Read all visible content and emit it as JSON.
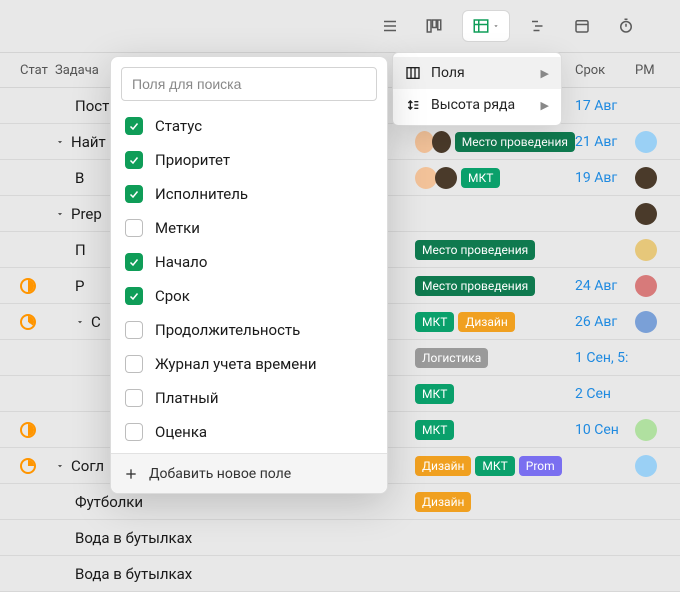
{
  "toolbar": {
    "icons": [
      "list-icon",
      "board-icon",
      "table-icon",
      "gantt-icon",
      "calendar-like-icon",
      "timer-icon"
    ],
    "active_index": 2
  },
  "columns": {
    "status": "Стат",
    "task": "Задача",
    "due": "Срок",
    "pm": "PM"
  },
  "view_popover": {
    "items": [
      {
        "icon": "columns-icon",
        "label": "Поля",
        "active": true,
        "has_sub": true
      },
      {
        "icon": "row-height-icon",
        "label": "Высота ряда",
        "active": false,
        "has_sub": true
      }
    ]
  },
  "fields_panel": {
    "search_placeholder": "Поля для поиска",
    "add_label": "Добавить новое поле",
    "items": [
      {
        "label": "Статус",
        "checked": true
      },
      {
        "label": "Приоритет",
        "checked": true
      },
      {
        "label": "Исполнитель",
        "checked": true
      },
      {
        "label": "Метки",
        "checked": false
      },
      {
        "label": "Начало",
        "checked": true
      },
      {
        "label": "Срок",
        "checked": true
      },
      {
        "label": "Продолжительность",
        "checked": false
      },
      {
        "label": "Журнал учета времени",
        "checked": false
      },
      {
        "label": "Платный",
        "checked": false
      },
      {
        "label": "Оценка",
        "checked": false
      }
    ]
  },
  "rows": [
    {
      "indent": 1,
      "disclose": false,
      "status": null,
      "title": "Пост",
      "tags": [],
      "due": "17 Авг",
      "avatars": []
    },
    {
      "indent": 0,
      "disclose": true,
      "status": null,
      "title": "Найт",
      "tags": [
        {
          "t": "Место проведения",
          "c": "green"
        }
      ],
      "due": "21 Авг",
      "avatars": [
        "a",
        "b",
        "c"
      ]
    },
    {
      "indent": 1,
      "disclose": false,
      "status": null,
      "title": "В",
      "tags": [
        {
          "t": "МКТ",
          "c": "teal"
        }
      ],
      "due": "19 Авг",
      "avatars": [
        "a",
        "b"
      ]
    },
    {
      "indent": 0,
      "disclose": true,
      "status": null,
      "title": "Prep",
      "tags": [],
      "due": "",
      "avatars": [
        "b"
      ]
    },
    {
      "indent": 1,
      "disclose": false,
      "status": null,
      "title": "П",
      "tags": [
        {
          "t": "Место проведения",
          "c": "green"
        }
      ],
      "due": "",
      "avatars": [
        "d"
      ]
    },
    {
      "indent": 1,
      "disclose": false,
      "status": "50",
      "title": "Р",
      "tags": [
        {
          "t": "Место проведения",
          "c": "green"
        }
      ],
      "due": "24 Авг",
      "avatars": [
        "e"
      ]
    },
    {
      "indent": 1,
      "disclose": true,
      "status": "35",
      "title": "С",
      "tags": [
        {
          "t": "МКТ",
          "c": "teal"
        },
        {
          "t": "Дизайн",
          "c": "orange"
        }
      ],
      "due": "26 Авг",
      "avatars": [
        "f"
      ]
    },
    {
      "indent": 2,
      "disclose": false,
      "status": null,
      "title": "",
      "tags": [
        {
          "t": "Логистика",
          "c": "gray"
        }
      ],
      "due": "1 Сен, 5:",
      "avatars": []
    },
    {
      "indent": 2,
      "disclose": false,
      "status": null,
      "title": "",
      "tags": [
        {
          "t": "МКТ",
          "c": "teal"
        }
      ],
      "due": "2 Сен",
      "avatars": []
    },
    {
      "indent": 2,
      "disclose": false,
      "status": "50",
      "title": "",
      "tags": [
        {
          "t": "МКТ",
          "c": "teal"
        }
      ],
      "due": "10 Сен",
      "avatars": [
        "g"
      ]
    },
    {
      "indent": 0,
      "disclose": true,
      "status": "25",
      "title": "Согл",
      "tags": [
        {
          "t": "Дизайн",
          "c": "orange"
        },
        {
          "t": "МКТ",
          "c": "teal"
        },
        {
          "t": "Prom",
          "c": "purple"
        }
      ],
      "due": "",
      "avatars": [
        "c"
      ]
    },
    {
      "indent": 1,
      "disclose": false,
      "status": null,
      "title": "Футболки",
      "tags": [
        {
          "t": "Дизайн",
          "c": "orange"
        }
      ],
      "due": "",
      "avatars": []
    },
    {
      "indent": 1,
      "disclose": false,
      "status": null,
      "title": "Вода в бутылках",
      "tags": [],
      "due": "",
      "avatars": []
    },
    {
      "indent": 1,
      "disclose": false,
      "status": null,
      "title": "Вода в бутылках",
      "tags": [],
      "due": "",
      "avatars": []
    }
  ]
}
